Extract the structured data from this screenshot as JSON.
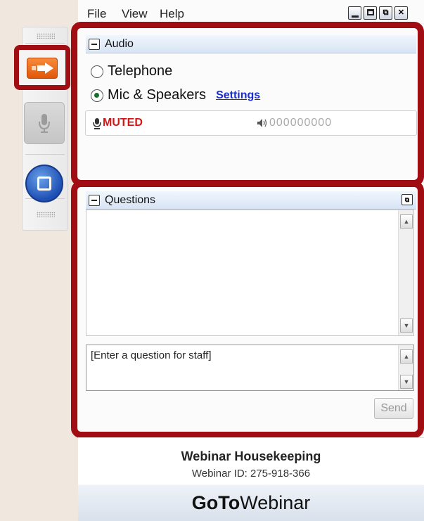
{
  "menubar": {
    "items": [
      "File",
      "View",
      "Help"
    ]
  },
  "window_buttons": [
    "minimize",
    "maximize",
    "restore",
    "close"
  ],
  "audio": {
    "title": "Audio",
    "options": [
      {
        "label": "Telephone",
        "selected": false
      },
      {
        "label": "Mic & Speakers",
        "selected": true
      }
    ],
    "settings_link": "Settings",
    "status": "MUTED",
    "level_meter": "000000000"
  },
  "questions": {
    "title": "Questions",
    "input_placeholder": "[Enter a question for staff]",
    "send_label": "Send"
  },
  "footer": {
    "title": "Webinar Housekeeping",
    "webinar_id": "Webinar ID: 275-918-366"
  },
  "brand": {
    "bold": "GoTo",
    "regular": "Webinar"
  },
  "colors": {
    "highlight_frame": "#a00d12",
    "accent_orange": "#e0570a",
    "stop_blue": "#1d4fb4",
    "muted_red": "#d01818",
    "link_blue": "#1b2fd1"
  }
}
